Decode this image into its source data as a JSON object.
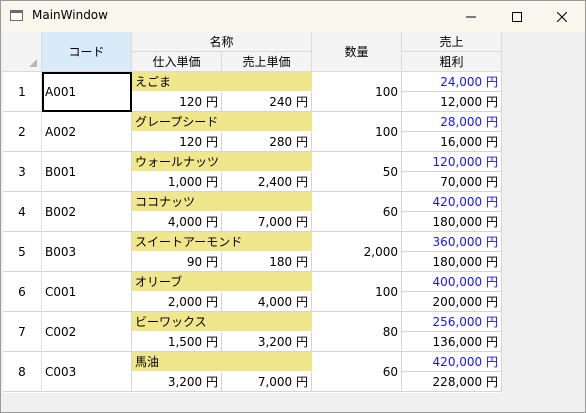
{
  "window": {
    "title": "MainWindow"
  },
  "columns": {
    "code": "コード",
    "name_group": "名称",
    "purchase_price": "仕入単価",
    "sale_price": "売上単価",
    "quantity": "数量",
    "sales_group": "売上",
    "gross_profit": "粗利"
  },
  "rows": [
    {
      "index": "1",
      "code": "A001",
      "name": "えごま",
      "purchase": "120 円",
      "sale": "240 円",
      "qty": "100",
      "sales": "24,000 円",
      "profit": "12,000 円"
    },
    {
      "index": "2",
      "code": "A002",
      "name": "グレープシード",
      "purchase": "120 円",
      "sale": "280 円",
      "qty": "100",
      "sales": "28,000 円",
      "profit": "16,000 円"
    },
    {
      "index": "3",
      "code": "B001",
      "name": "ウォールナッツ",
      "purchase": "1,000 円",
      "sale": "2,400 円",
      "qty": "50",
      "sales": "120,000 円",
      "profit": "70,000 円"
    },
    {
      "index": "4",
      "code": "B002",
      "name": "ココナッツ",
      "purchase": "4,000 円",
      "sale": "7,000 円",
      "qty": "60",
      "sales": "420,000 円",
      "profit": "180,000 円"
    },
    {
      "index": "5",
      "code": "B003",
      "name": "スイートアーモンド",
      "purchase": "90 円",
      "sale": "180 円",
      "qty": "2,000",
      "sales": "360,000 円",
      "profit": "180,000 円"
    },
    {
      "index": "6",
      "code": "C001",
      "name": "オリーブ",
      "purchase": "2,000 円",
      "sale": "4,000 円",
      "qty": "100",
      "sales": "400,000 円",
      "profit": "200,000 円"
    },
    {
      "index": "7",
      "code": "C002",
      "name": "ビーワックス",
      "purchase": "1,500 円",
      "sale": "3,200 円",
      "qty": "80",
      "sales": "256,000 円",
      "profit": "136,000 円"
    },
    {
      "index": "8",
      "code": "C003",
      "name": "馬油",
      "purchase": "3,200 円",
      "sale": "7,000 円",
      "qty": "60",
      "sales": "420,000 円",
      "profit": "228,000 円"
    }
  ],
  "colors": {
    "name_highlight": "#f0e68c",
    "sales_text": "#1515ff",
    "header_selected": "#d9ebf9"
  }
}
